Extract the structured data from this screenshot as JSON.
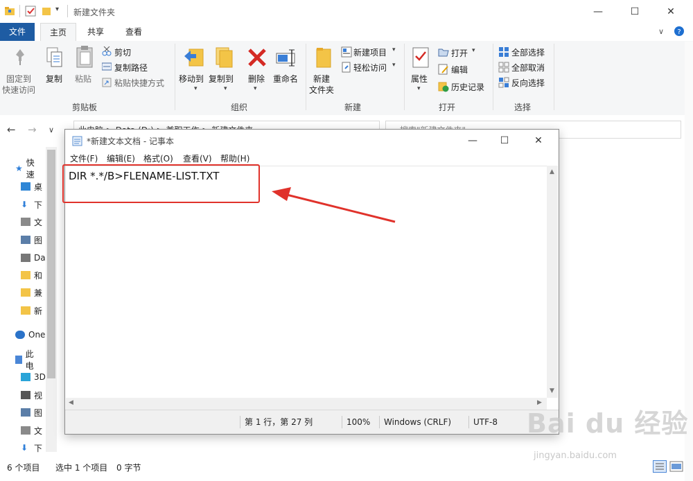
{
  "explorer": {
    "title": "新建文件夹",
    "tabs": [
      "文件",
      "主页",
      "共享",
      "查看"
    ],
    "ribbon": {
      "clipboard": {
        "pin_label_1": "固定到",
        "pin_label_2": "快速访问",
        "copy": "复制",
        "paste": "粘贴",
        "cut": "剪切",
        "copy_path": "复制路径",
        "paste_shortcut": "粘贴快捷方式",
        "group": "剪贴板"
      },
      "organize": {
        "move_to": "移动到",
        "copy_to": "复制到",
        "delete": "删除",
        "rename": "重命名",
        "group": "组织"
      },
      "new": {
        "new_folder_1": "新建",
        "new_folder_2": "文件夹",
        "new_item": "新建项目",
        "easy_access": "轻松访问",
        "group": "新建"
      },
      "open": {
        "properties": "属性",
        "open": "打开",
        "edit": "编辑",
        "history": "历史记录",
        "group": "打开"
      },
      "select": {
        "select_all": "全部选择",
        "select_none": "全部取消",
        "invert": "反向选择",
        "group": "选择"
      }
    },
    "address": {
      "crumbs": [
        "此电脑",
        "Data (D:)",
        "兼职工作",
        "新建文件夹"
      ],
      "search_placeholder": "搜索\"新建文件夹\""
    },
    "nav": [
      {
        "label": "快速",
        "icon": "star-icon"
      },
      {
        "label": "桌",
        "icon": "desktop-icon"
      },
      {
        "label": "下",
        "icon": "download-icon"
      },
      {
        "label": "文",
        "icon": "document-icon"
      },
      {
        "label": "图",
        "icon": "picture-icon"
      },
      {
        "label": "Da",
        "icon": "drive-icon"
      },
      {
        "label": "和",
        "icon": "folder-pin-icon"
      },
      {
        "label": "兼",
        "icon": "folder-pin-icon"
      },
      {
        "label": "新",
        "icon": "folder-pin-icon"
      },
      {
        "label": "One",
        "icon": "cloud-icon"
      },
      {
        "label": "此电",
        "icon": "computer-icon"
      },
      {
        "label": "3D",
        "icon": "3d-objects-icon"
      },
      {
        "label": "视",
        "icon": "video-icon"
      },
      {
        "label": "图",
        "icon": "picture-icon"
      },
      {
        "label": "文",
        "icon": "document-icon"
      },
      {
        "label": "下",
        "icon": "download-icon"
      }
    ],
    "status": {
      "count": "6 个项目",
      "selected": "选中 1 个项目",
      "size": "0 字节"
    }
  },
  "notepad": {
    "title": "*新建文本文档 - 记事本",
    "menu": [
      "文件(F)",
      "编辑(E)",
      "格式(O)",
      "查看(V)",
      "帮助(H)"
    ],
    "content": "DIR *.*/B>FLENAME-LIST.TXT",
    "status": {
      "position": "第 1 行，第 27 列",
      "zoom": "100%",
      "line_ending": "Windows (CRLF)",
      "encoding": "UTF-8"
    }
  },
  "watermark": {
    "logo": "Bai du 经验",
    "url": "jingyan.baidu.com"
  },
  "colors": {
    "file_tab": "#1e5ca3",
    "annotation_red": "#e0322b",
    "ribbon_bg": "#f5f6f7"
  }
}
